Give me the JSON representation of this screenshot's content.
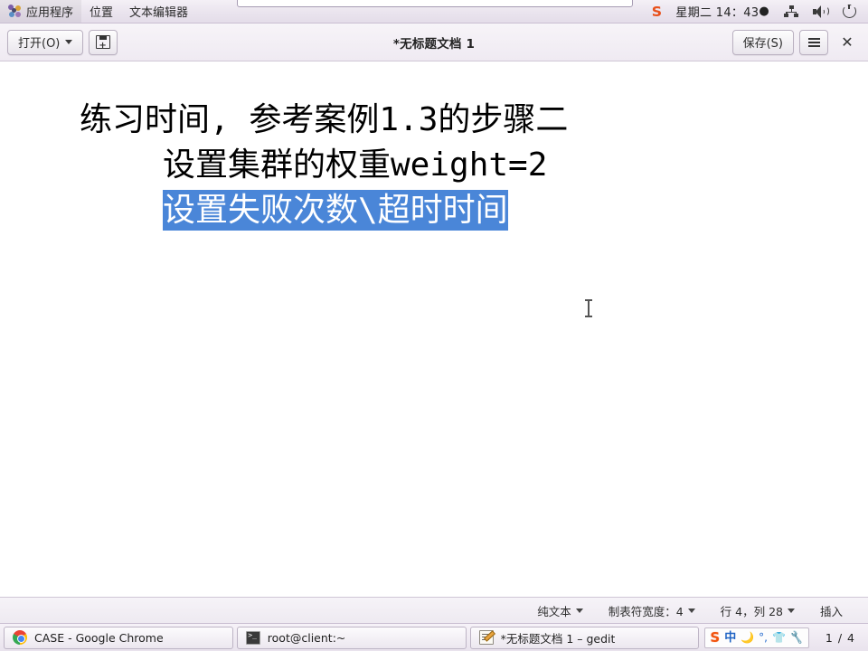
{
  "top_panel": {
    "apps_menu": "应用程序",
    "places_menu": "位置",
    "editor_menu": "文本编辑器",
    "apps_icon": "gnome-foot-icon",
    "tray_sogou": "S",
    "clock": "星期二  14：43",
    "clock_dot": "●",
    "network_icon": "network-icon",
    "volume_icon": "volume-icon",
    "power_icon": "power-icon"
  },
  "headerbar": {
    "open_label": "打开(O)",
    "open_caret": "chevron-down-icon",
    "new_save_icon": "save-as-icon",
    "title": "*无标题文档 1",
    "save_label": "保存(S)",
    "menu_icon": "hamburger-menu-icon",
    "close_label": "✕"
  },
  "editor": {
    "lines": [
      {
        "text": "练习时间, 参考案例1.3的步骤二",
        "selected": false,
        "indent": 0
      },
      {
        "text": "设置集群的权重weight=2",
        "selected": false,
        "indent": 92
      },
      {
        "text": "设置失败次数\\超时时间",
        "selected": true,
        "indent": 92
      }
    ],
    "selection_color": "#4a86d8",
    "selection_text_color": "#ffffff",
    "text_color": "#000000",
    "background": "#ffffff",
    "cursor": "i-beam"
  },
  "statusbar": {
    "syntax": "纯文本",
    "syntax_caret": "chevron-down-icon",
    "tab_width": "制表符宽度：4",
    "tab_caret": "chevron-down-icon",
    "position": "行 4，列 28",
    "position_caret": "chevron-down-icon",
    "insert_mode": "插入"
  },
  "taskbar": {
    "items": [
      {
        "label": "CASE - Google Chrome",
        "icon": "chrome-icon"
      },
      {
        "label": "root@client:~",
        "icon": "terminal-icon"
      },
      {
        "label": "*无标题文档 1 – gedit",
        "icon": "gedit-icon"
      }
    ],
    "sogou": {
      "logo": "S",
      "mode": "中",
      "moon_icon": "moon-icon",
      "punct_icon": "°,",
      "skin_icon": "shirt-icon",
      "tools_icon": "wrench-icon"
    },
    "workspace": "1 / 4"
  }
}
